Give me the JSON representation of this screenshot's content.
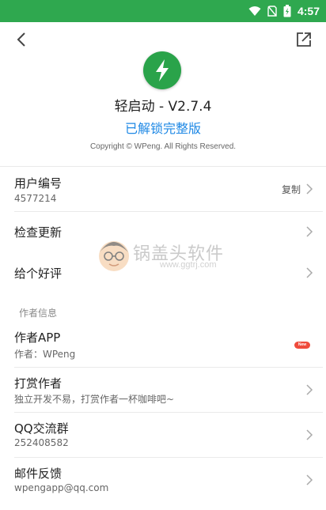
{
  "status_bar": {
    "time": "4:57",
    "icons": [
      "wifi-icon",
      "no-sim-icon",
      "battery-icon"
    ]
  },
  "header": {
    "back_icon": "back-arrow-icon",
    "share_icon": "open-external-icon"
  },
  "app": {
    "logo_icon": "lightning-bolt-icon",
    "title": "轻启动 - V2.7.4",
    "unlock_text": "已解锁完整版",
    "copyright": "Copyright © WPeng. All Rights Reserved."
  },
  "rows": {
    "user_id": {
      "title": "用户编号",
      "value": "4577214",
      "action": "复制"
    },
    "check_update": {
      "title": "检查更新"
    },
    "rate": {
      "title": "给个好评"
    }
  },
  "author_section": {
    "heading": "作者信息",
    "author_app": {
      "title": "作者APP",
      "subtitle": "作者：WPeng",
      "badge": "New"
    },
    "tip": {
      "title": "打赏作者",
      "subtitle": "独立开发不易，打赏作者一杯咖啡吧~"
    },
    "qq_group": {
      "title": "QQ交流群",
      "subtitle": "252408582"
    },
    "feedback": {
      "title": "邮件反馈",
      "subtitle": "wpengapp@qq.com"
    }
  },
  "watermark": {
    "text": "锅盖头软件",
    "url": "www.ggtrj.com"
  },
  "colors": {
    "status_bar": "#2fa84f",
    "logo": "#2aa34a",
    "accent": "#1e88e5",
    "badge": "#ef4b3c"
  }
}
